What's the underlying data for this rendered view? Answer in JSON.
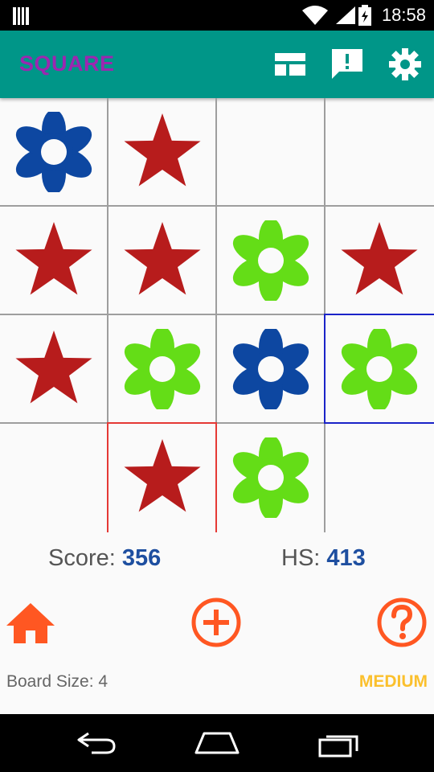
{
  "status_bar": {
    "time": "18:58"
  },
  "app_bar": {
    "title": "SQUARE",
    "actions": [
      "dashboard-icon",
      "feedback-icon",
      "settings-icon"
    ]
  },
  "board": {
    "size": 4,
    "cells": [
      [
        "blue-flower",
        "red-star",
        "",
        ""
      ],
      [
        "red-star",
        "red-star",
        "green-flower",
        "red-star"
      ],
      [
        "red-star",
        "green-flower",
        "blue-flower",
        "green-flower"
      ],
      [
        "",
        "red-star",
        "green-flower",
        ""
      ]
    ],
    "selected_red": [
      3,
      1
    ],
    "selected_blue": [
      2,
      3
    ]
  },
  "score": {
    "label": "Score:",
    "value": "356"
  },
  "high_score": {
    "label": "HS:",
    "value": "413"
  },
  "controls": [
    "home-icon",
    "add-circle-icon",
    "help-icon"
  ],
  "footer": {
    "board_size": "Board Size: 4",
    "difficulty": "MEDIUM"
  },
  "colors": {
    "app_bar": "#009688",
    "title": "#9c27b0",
    "star": "#b71c1c",
    "flower_blue": "#0d47a1",
    "flower_green": "#64dd17",
    "control": "#ff5722",
    "difficulty": "#fbc02d",
    "score_value": "#1e4fa0"
  }
}
